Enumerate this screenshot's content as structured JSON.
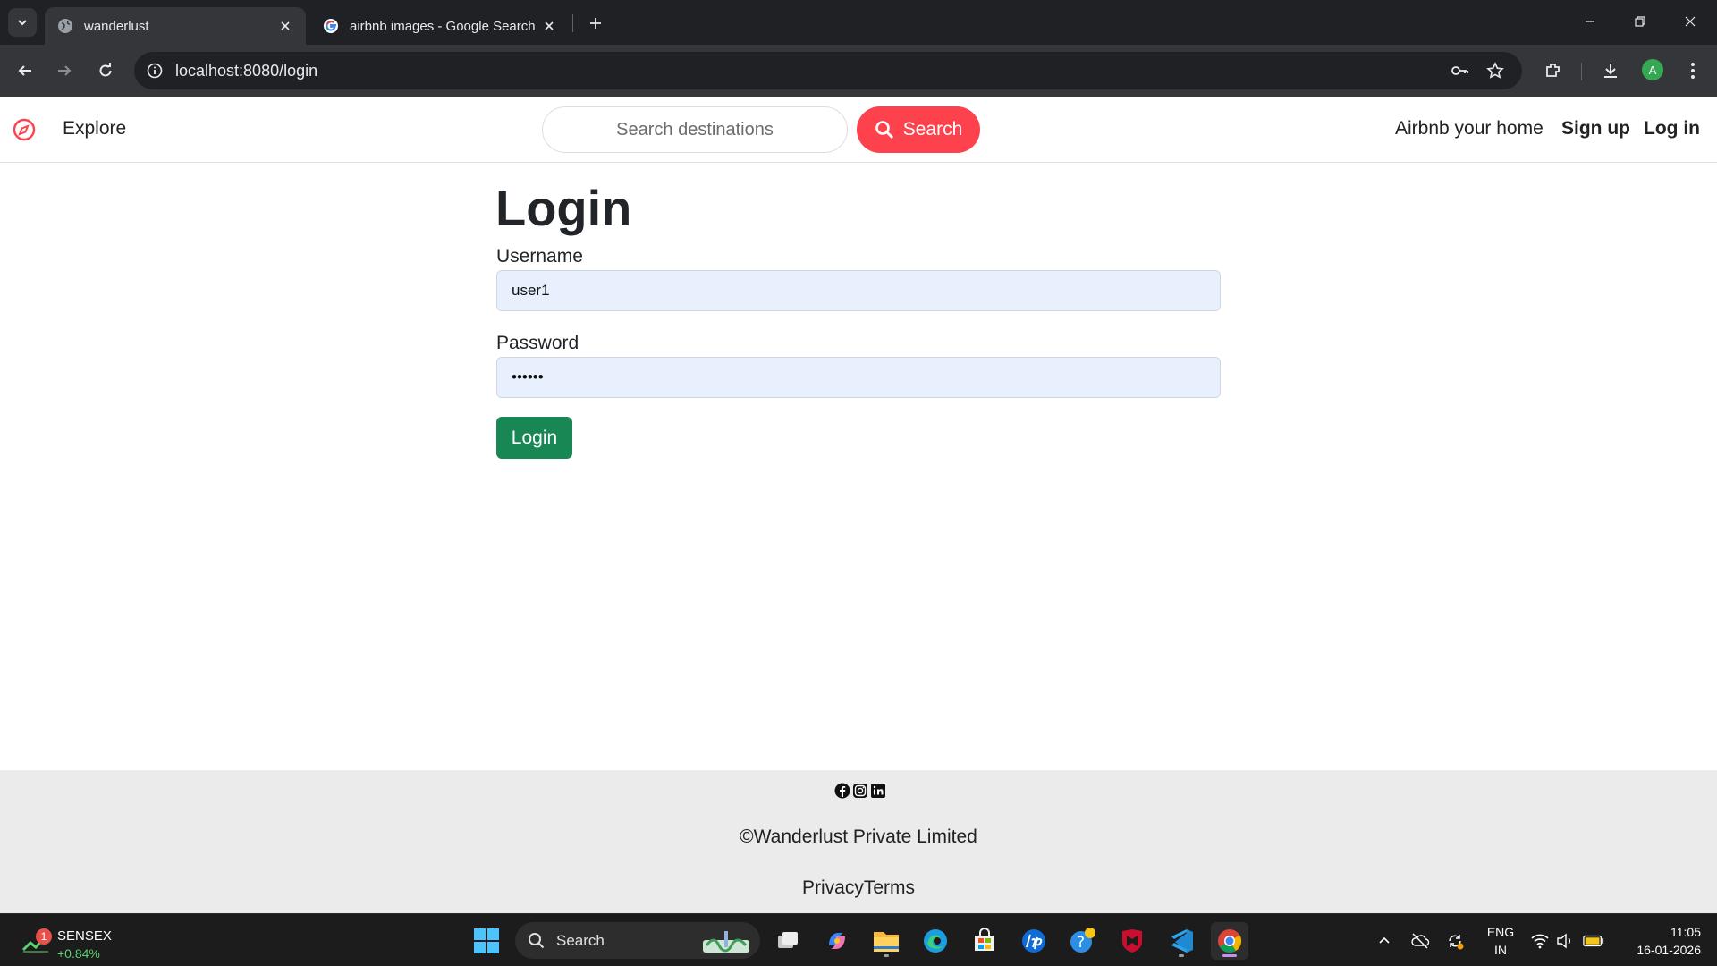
{
  "browser": {
    "tabs": [
      {
        "title": "wanderlust",
        "active": true
      },
      {
        "title": "airbnb images - Google Search",
        "active": false
      }
    ],
    "url": "localhost:8080/login",
    "profile_initial": "A"
  },
  "site": {
    "nav": {
      "explore": "Explore",
      "search_placeholder": "Search destinations",
      "search_button": "Search",
      "airbnb_home": "Airbnb your home",
      "signup": "Sign up",
      "login": "Log in"
    },
    "login_form": {
      "title": "Login",
      "username_label": "Username",
      "username_value": "user1",
      "password_label": "Password",
      "password_value": "••••••",
      "submit": "Login"
    },
    "footer": {
      "socials": [
        "facebook-icon",
        "instagram-icon",
        "linkedin-icon"
      ],
      "copyright": "©Wanderlust Private Limited",
      "links": "PrivacyTerms"
    },
    "colors": {
      "brand": "#fe424d",
      "submit": "#198754",
      "input_bg": "#e8f0fe"
    }
  },
  "taskbar": {
    "widget": {
      "badge": "1",
      "name": "SENSEX",
      "change": "+0.84%"
    },
    "search_label": "Search",
    "apps": [
      "windows-start-icon",
      "task-view-icon",
      "copilot-icon",
      "file-explorer-icon",
      "edge-icon",
      "microsoft-store-icon",
      "hp-icon",
      "help-icon",
      "mcafee-icon",
      "vscode-icon",
      "chrome-icon"
    ],
    "language": {
      "line1": "ENG",
      "line2": "IN"
    },
    "clock": {
      "time": "11:05",
      "date": "16-01-2026"
    }
  }
}
